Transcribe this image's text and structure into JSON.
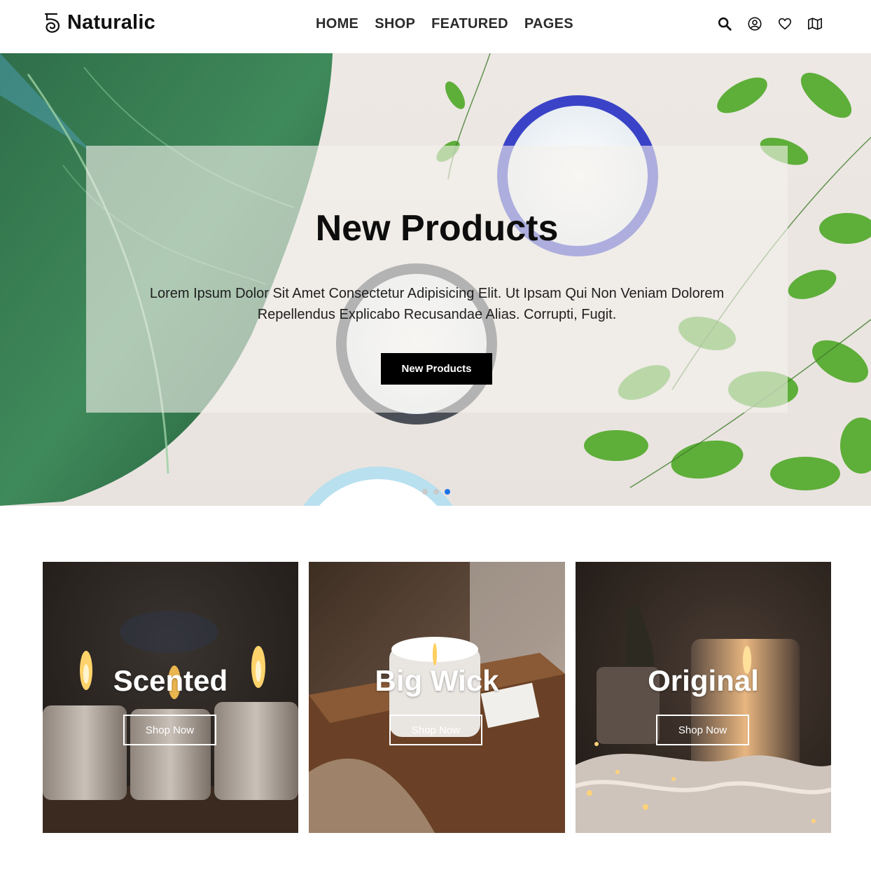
{
  "brand": {
    "name": "Naturalic",
    "logo_icon": "spiral-five-icon"
  },
  "nav": {
    "items": [
      {
        "label": "HOME"
      },
      {
        "label": "SHOP"
      },
      {
        "label": "FEATURED"
      },
      {
        "label": "PAGES"
      }
    ]
  },
  "header_actions": [
    {
      "icon": "search-icon"
    },
    {
      "icon": "user-icon"
    },
    {
      "icon": "heart-icon"
    },
    {
      "icon": "map-icon"
    }
  ],
  "hero": {
    "title": "New Products",
    "text": "Lorem Ipsum Dolor Sit Amet Consectetur Adipisicing Elit. Ut Ipsam Qui Non Veniam Dolorem Repellendus Explicabo Recusandae Alias. Corrupti, Fugit.",
    "button_label": "New Products",
    "slides": 3,
    "active_slide": 3
  },
  "categories": [
    {
      "title": "Scented",
      "button_label": "Shop Now"
    },
    {
      "title": "Big Wick",
      "button_label": "Shop Now"
    },
    {
      "title": "Original",
      "button_label": "Shop Now"
    }
  ],
  "colors": {
    "accent_dot": "#1a73e8",
    "button_dark": "#000000",
    "text_dark": "#111111"
  }
}
